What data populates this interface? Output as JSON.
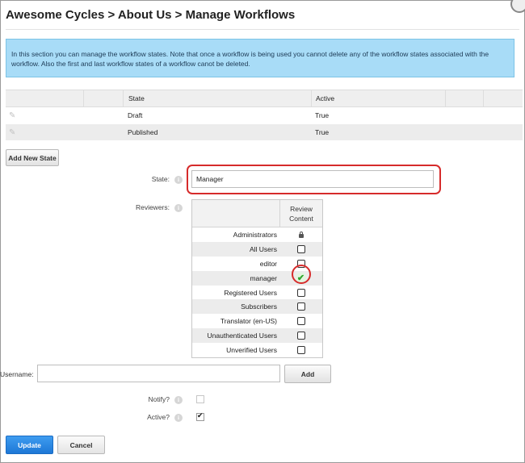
{
  "title": "Awesome Cycles > About Us > Manage Workflows",
  "info_text": "In this section you can manage the workflow states. Note that once a workflow is being used you cannot delete any of the workflow states associated with the workflow. Also the first and last workflow states of a workflow canot be deleted.",
  "states_grid": {
    "headers": {
      "state": "State",
      "active": "Active"
    },
    "rows": [
      {
        "state": "Draft",
        "active": "True",
        "icon": "pencil-icon"
      },
      {
        "state": "Published",
        "active": "True",
        "icon": "pencil-icon"
      }
    ]
  },
  "add_new_state_label": "Add New State",
  "state_field": {
    "label": "State:",
    "value": "Manager"
  },
  "reviewers": {
    "label": "Reviewers:",
    "column_header": "Review Content",
    "items": [
      {
        "name": "Administrators",
        "control": "lock",
        "checked": false
      },
      {
        "name": "All Users",
        "control": "checkbox",
        "checked": false
      },
      {
        "name": "editor",
        "control": "checkbox",
        "checked": false
      },
      {
        "name": "manager",
        "control": "checkbox",
        "checked": true
      },
      {
        "name": "Registered Users",
        "control": "checkbox",
        "checked": false
      },
      {
        "name": "Subscribers",
        "control": "checkbox",
        "checked": false
      },
      {
        "name": "Translator (en-US)",
        "control": "checkbox",
        "checked": false
      },
      {
        "name": "Unauthenticated Users",
        "control": "checkbox",
        "checked": false
      },
      {
        "name": "Unverified Users",
        "control": "checkbox",
        "checked": false
      }
    ]
  },
  "username": {
    "label": "Username:",
    "value": "",
    "add_label": "Add"
  },
  "notify": {
    "label": "Notify?",
    "checked": false
  },
  "active": {
    "label": "Active?",
    "checked": true
  },
  "update_label": "Update",
  "cancel_label": "Cancel",
  "colors": {
    "info_bg": "#a8dcf7",
    "highlight": "#d62b2b",
    "primary": "#2a86e3",
    "check": "#2fa52f"
  }
}
